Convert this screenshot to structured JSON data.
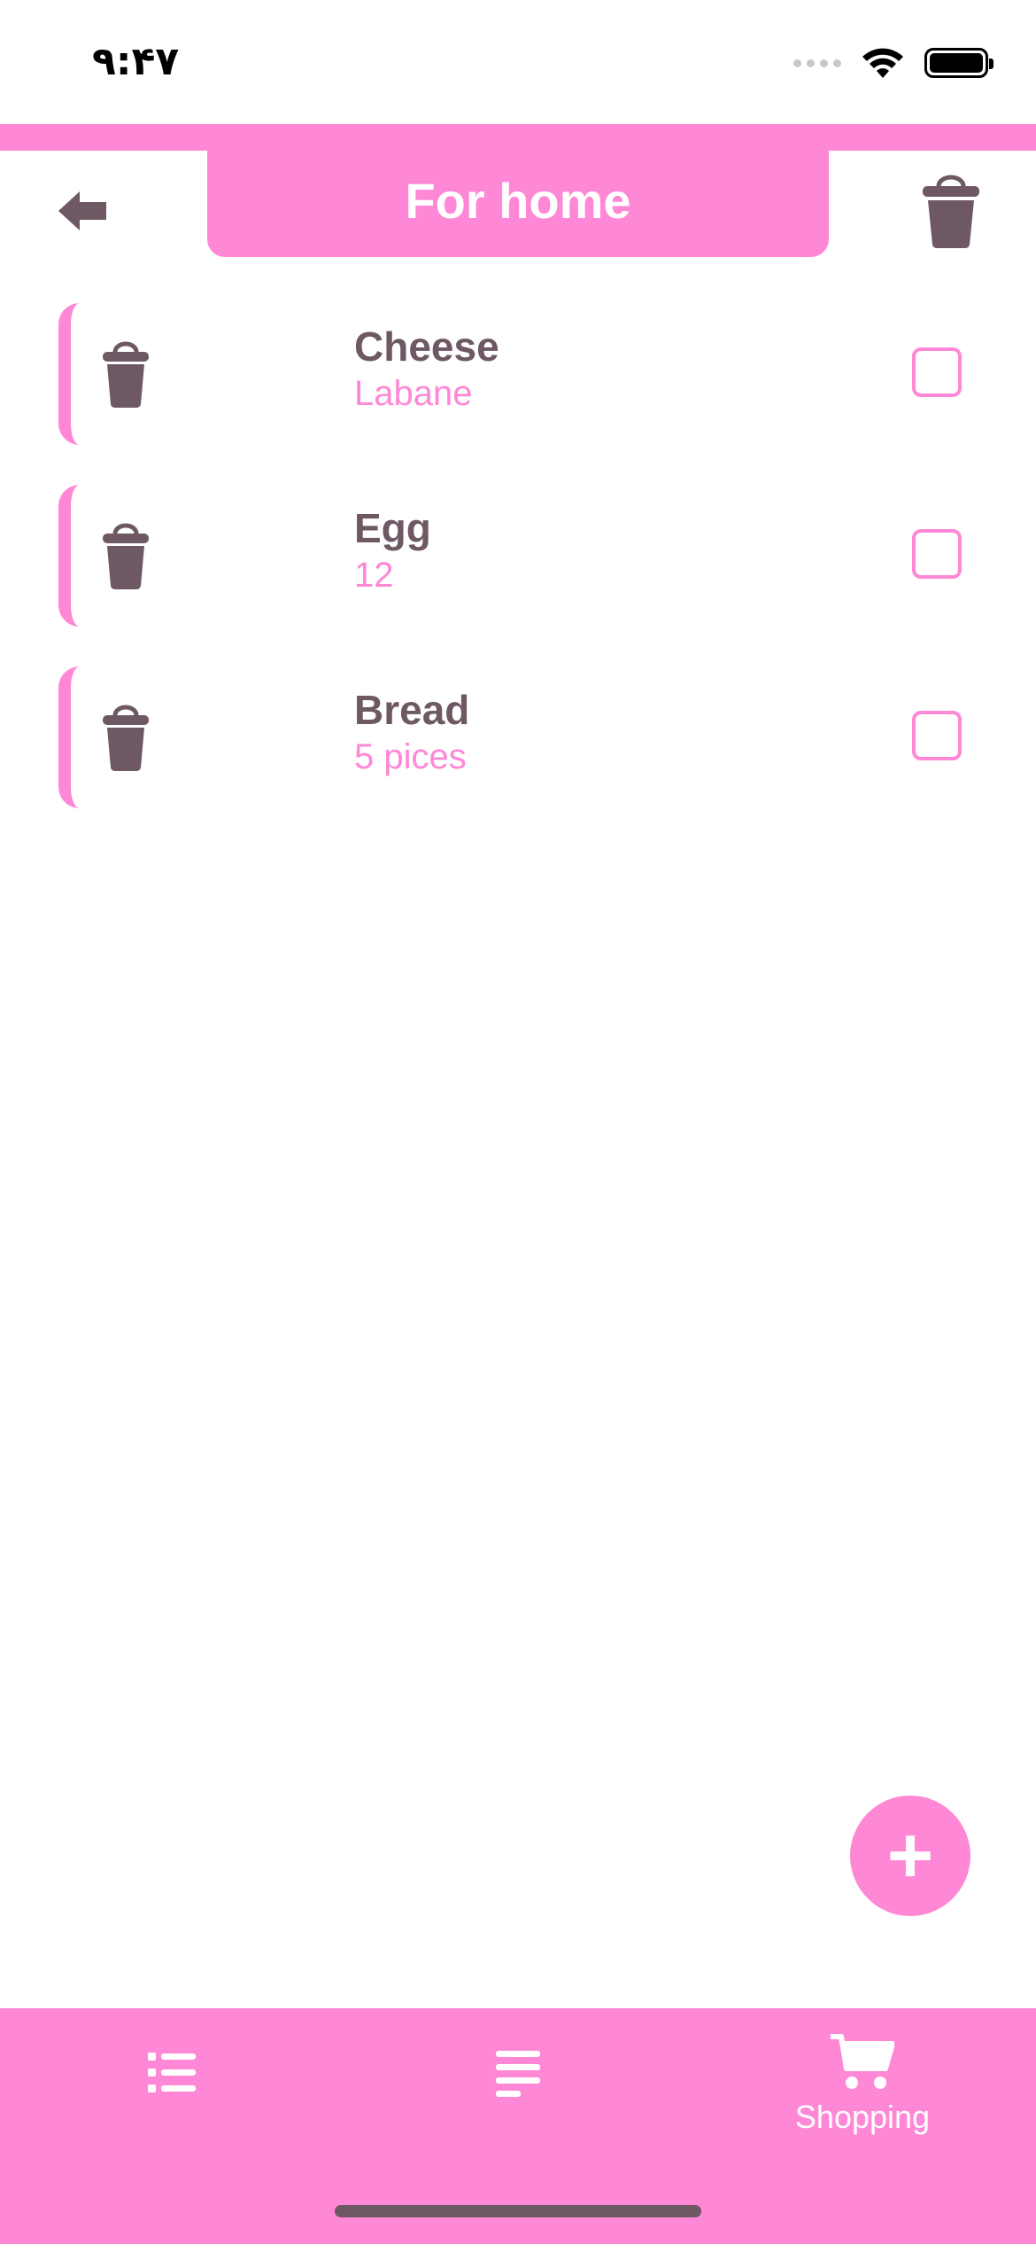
{
  "status_bar": {
    "time": "۹:۴۷"
  },
  "header": {
    "title": "For home"
  },
  "items": [
    {
      "name": "Cheese",
      "detail": "Labane"
    },
    {
      "name": "Egg",
      "detail": "12"
    },
    {
      "name": "Bread",
      "detail": "5 pices"
    }
  ],
  "fab": {
    "label": "+"
  },
  "bottom_nav": {
    "shopping_label": "Shopping"
  },
  "colors": {
    "accent": "#ff88d6",
    "icon": "#6e5864"
  }
}
